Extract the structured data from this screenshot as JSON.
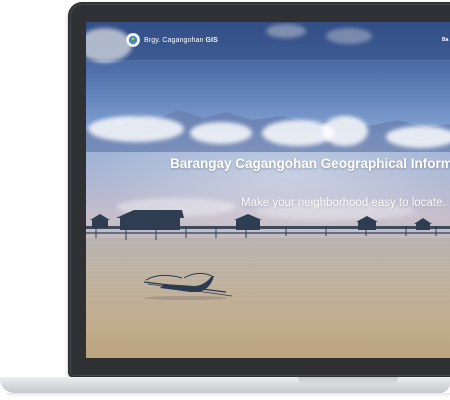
{
  "site": {
    "brand_prefix": "Brgy. Cagangohan ",
    "brand_suffix": "GIS",
    "logo_icon": "barangay-seal-icon"
  },
  "nav": {
    "items": [
      {
        "label": "Ba"
      }
    ]
  },
  "hero": {
    "title": "Barangay Cagangohan Geographical Information",
    "subtitle": "Make your neighborhood easy to locate."
  },
  "colors": {
    "bezel": "#2f3134",
    "sky_top": "#3c5a95",
    "water": "#bfb19e",
    "text": "#ffffff"
  }
}
